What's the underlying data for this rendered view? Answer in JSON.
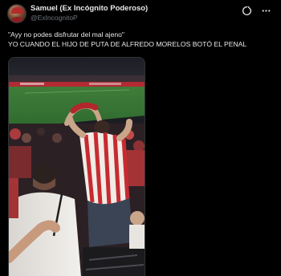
{
  "author": {
    "display_name": "Samuel (Ex Incógnito Poderoso)",
    "handle": "@ExIncognitoP",
    "avatar_icon": "profile-photo-avatar"
  },
  "header_icons": [
    "grok-icon",
    "more-options-icon"
  ],
  "tweet": {
    "line1": "\"Ayy no podes disfrutar del mal ajeno\"",
    "line2": "YO CUANDO EL HIJO DE PUTA DE ALFREDO MORELOS BOTÓ EL PENAL"
  },
  "media": {
    "type": "video-still",
    "description_icon": "stadium-crowd-image"
  },
  "colors": {
    "background": "#000000",
    "text_primary": "#e7e9ea",
    "text_secondary": "#71767b",
    "border": "#2f3336"
  }
}
